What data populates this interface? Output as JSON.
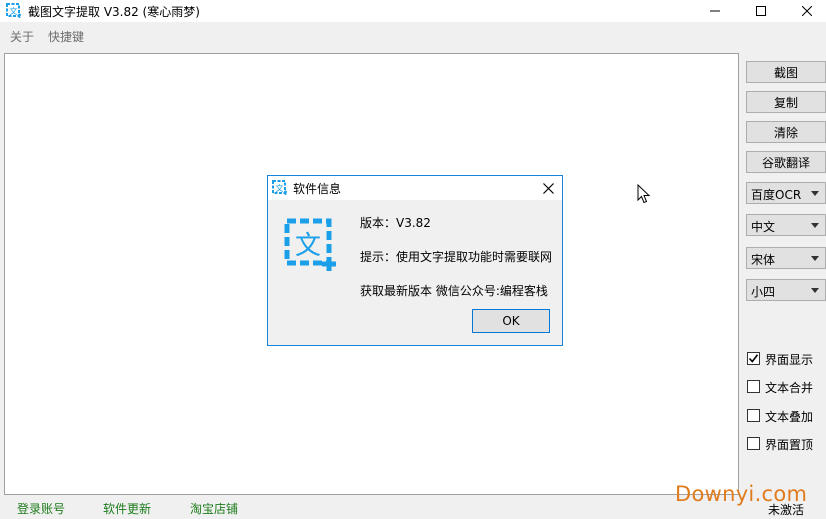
{
  "window": {
    "title": "截图文字提取 V3.82 (寒心雨梦)",
    "icons": [
      "app-icon",
      "minimize-icon",
      "maximize-icon",
      "close-icon"
    ]
  },
  "menu": {
    "items": [
      {
        "label": "关于"
      },
      {
        "label": "快捷键"
      }
    ]
  },
  "side_buttons": {
    "screenshot": "截图",
    "copy": "复制",
    "clear": "清除",
    "google_translate": "谷歌翻译"
  },
  "selects": {
    "ocr_engine": "百度OCR",
    "language": "中文",
    "font": "宋体",
    "size": "小四"
  },
  "checkboxes": [
    {
      "label": "界面显示",
      "checked": true
    },
    {
      "label": "文本合并",
      "checked": false
    },
    {
      "label": "文本叠加",
      "checked": false
    },
    {
      "label": "界面置顶",
      "checked": false
    }
  ],
  "status_bar": {
    "login": "登录账号",
    "update": "软件更新",
    "shop": "淘宝店铺",
    "activation": "未激活"
  },
  "watermark": "Downyi.com",
  "dialog": {
    "title": "软件信息",
    "version": "版本：V3.82",
    "hint": "提示：使用文字提取功能时需要联网",
    "latest": "获取最新版本 微信公众号:编程客栈",
    "ok_label": "OK"
  },
  "colors": {
    "accent": "#0078d7",
    "icon_blue": "#1a9fe8",
    "link_green": "#1c7c1c",
    "watermark_orange": "#e07c1e"
  }
}
